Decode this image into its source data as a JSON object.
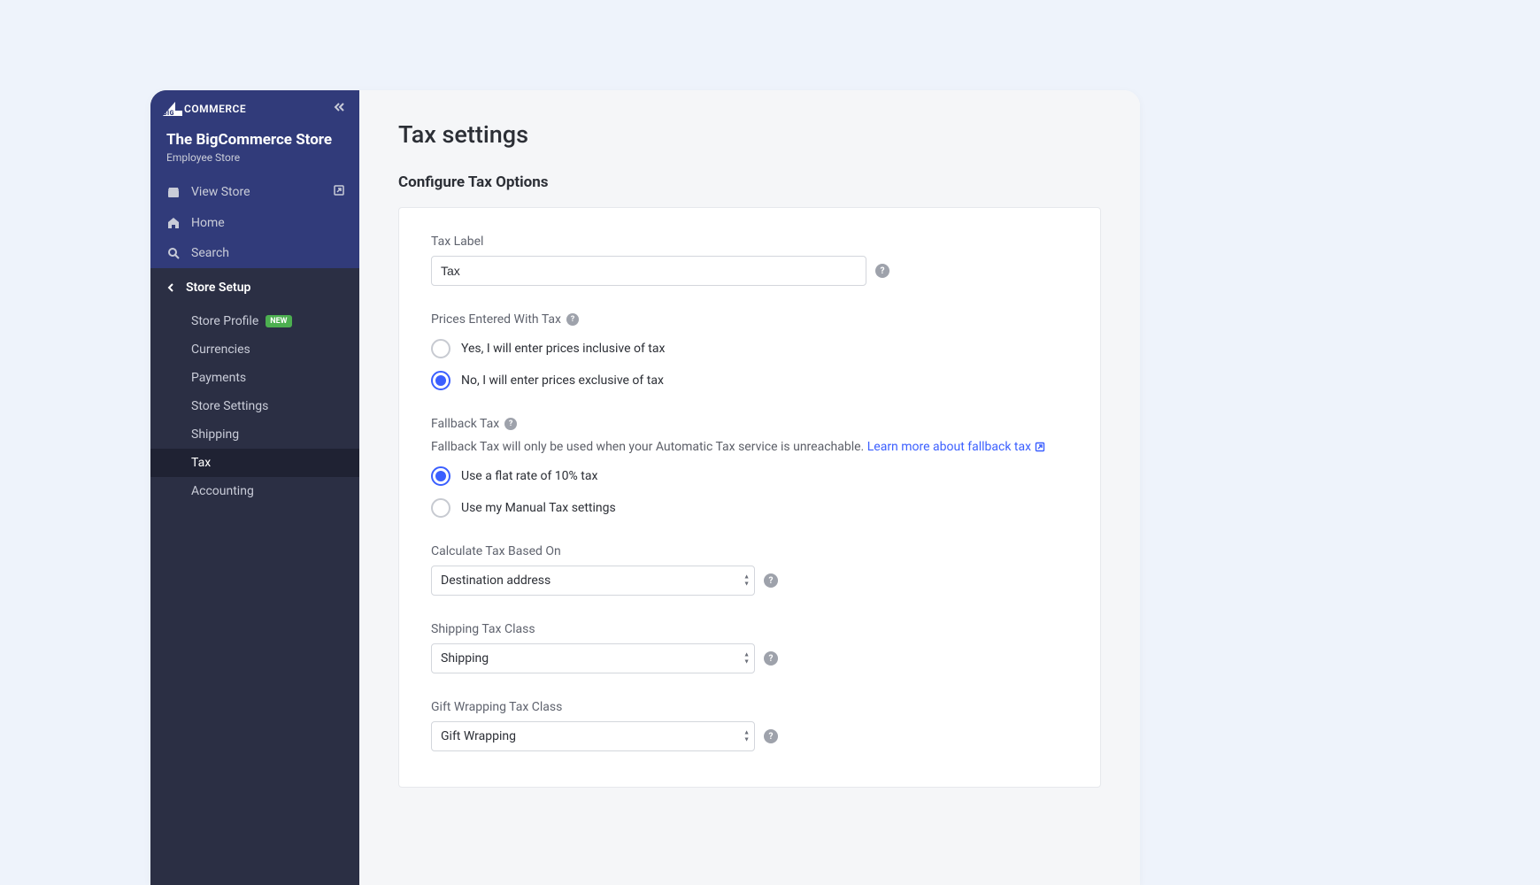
{
  "logo": {
    "text": "COMMERCE"
  },
  "store": {
    "name": "The BigCommerce Store",
    "sub": "Employee Store"
  },
  "nav": {
    "view_store": "View Store",
    "home": "Home",
    "search": "Search"
  },
  "section": {
    "title": "Store Setup",
    "items": [
      {
        "label": "Store Profile",
        "badge": "NEW"
      },
      {
        "label": "Currencies"
      },
      {
        "label": "Payments"
      },
      {
        "label": "Store Settings"
      },
      {
        "label": "Shipping"
      },
      {
        "label": "Tax",
        "active": true
      },
      {
        "label": "Accounting"
      }
    ]
  },
  "page_title": "Tax settings",
  "section_heading": "Configure Tax Options",
  "tax_label": {
    "label": "Tax Label",
    "value": "Tax"
  },
  "prices_entered": {
    "label": "Prices Entered With Tax",
    "opt_yes": "Yes, I will enter prices inclusive of tax",
    "opt_no": "No, I will enter prices exclusive of tax",
    "selected": "no"
  },
  "fallback": {
    "label": "Fallback Tax",
    "hint": "Fallback Tax will only be used when your Automatic Tax service is unreachable. ",
    "link": "Learn more about fallback tax",
    "opt_flat": "Use a flat rate of 10% tax",
    "opt_manual": "Use my Manual Tax settings",
    "selected": "flat"
  },
  "calc_based": {
    "label": "Calculate Tax Based On",
    "value": "Destination address"
  },
  "shipping_class": {
    "label": "Shipping Tax Class",
    "value": "Shipping"
  },
  "gift_class": {
    "label": "Gift Wrapping Tax Class",
    "value": "Gift Wrapping"
  }
}
